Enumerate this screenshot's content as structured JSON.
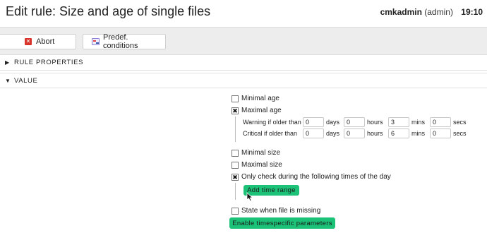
{
  "header": {
    "title": "Edit rule: Size and age of single files",
    "username": "cmkadmin",
    "role": "(admin)",
    "time": "19:10"
  },
  "toolbar": {
    "abort_label": "Abort",
    "abort_icon": "abort-icon",
    "predef_label": "Predef. conditions",
    "predef_icon": "predef-conditions-icon"
  },
  "sections": {
    "rule_properties": {
      "label": "RULE PROPERTIES",
      "expanded": false
    },
    "value": {
      "label": "VALUE",
      "expanded": true
    }
  },
  "value_form": {
    "minimal_age": {
      "label": "Minimal age",
      "checked": false
    },
    "maximal_age": {
      "label": "Maximal age",
      "checked": true,
      "warning": {
        "label": "Warning if older than",
        "days": "0",
        "hours": "0",
        "mins": "3",
        "secs": "0"
      },
      "critical": {
        "label": "Critical if older than",
        "days": "0",
        "hours": "0",
        "mins": "6",
        "secs": "0"
      }
    },
    "units": {
      "days": "days",
      "hours": "hours",
      "mins": "mins",
      "secs": "secs"
    },
    "minimal_size": {
      "label": "Minimal size",
      "checked": false
    },
    "maximal_size": {
      "label": "Maximal size",
      "checked": false
    },
    "only_check_times": {
      "label": "Only check during the following times of the day",
      "checked": true
    },
    "add_time_range_label": "Add time range",
    "state_missing": {
      "label": "State when file is missing",
      "checked": false
    },
    "enable_timespecific_label": "Enable timespecific parameters"
  },
  "colors": {
    "accent_green": "#1cc277",
    "abort_red": "#d9342b",
    "toolbar_bg": "#ededed"
  }
}
